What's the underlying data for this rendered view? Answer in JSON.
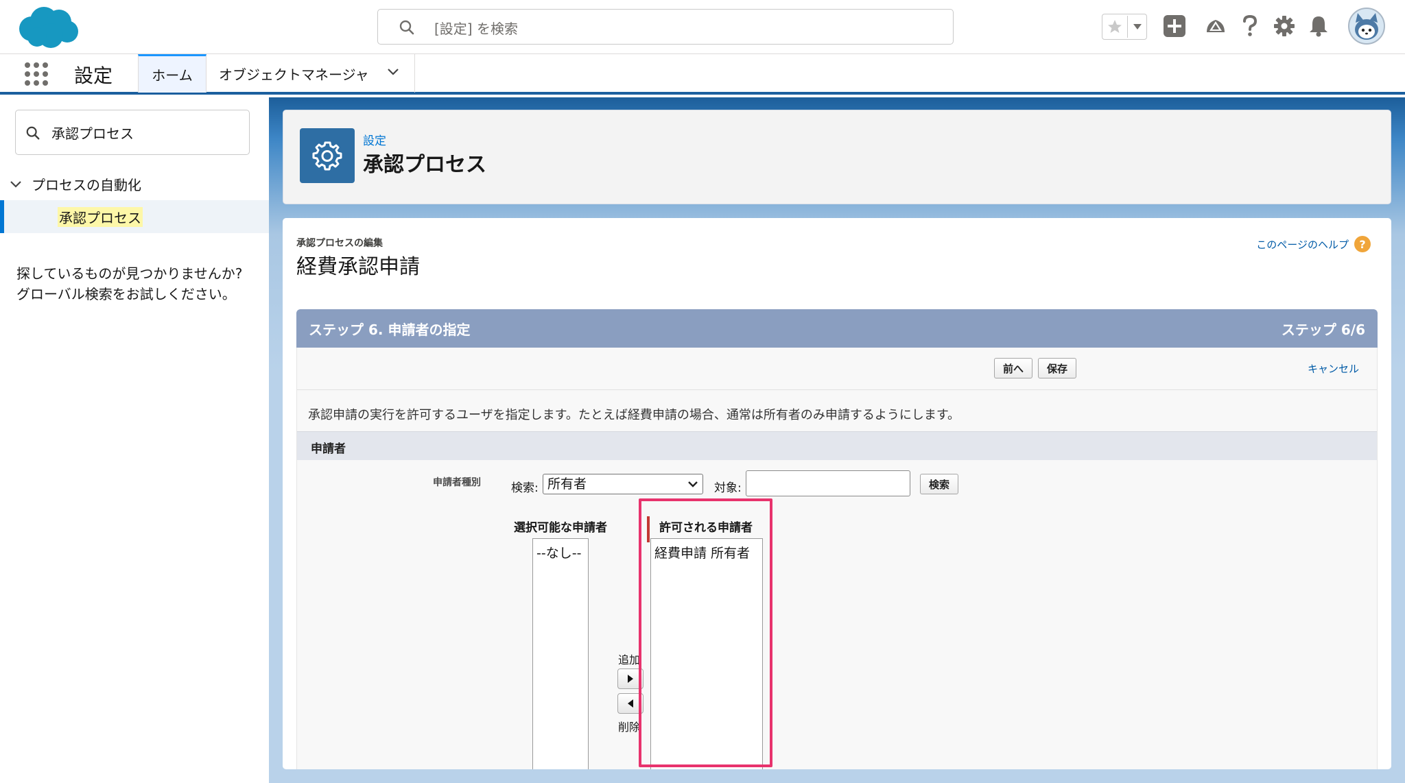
{
  "header": {
    "search_placeholder": "[設定] を検索",
    "icons": [
      "salesforce-cloud-icon",
      "search-icon",
      "star-icon",
      "chevron-down-icon",
      "plus-icon",
      "trailhead-icon",
      "help-icon",
      "gear-icon",
      "bell-icon",
      "avatar"
    ]
  },
  "nav": {
    "app_name": "設定",
    "tabs": [
      {
        "label": "ホーム",
        "active": true
      },
      {
        "label": "オブジェクトマネージャ",
        "active": false
      }
    ]
  },
  "sidebar": {
    "quick_find_value": "承認プロセス",
    "tree_parent": "プロセスの自動化",
    "tree_child": "承認プロセス",
    "help_line1": "探しているものが見つかりませんか?",
    "help_line2": "グローバル検索をお試しください。"
  },
  "page_header": {
    "breadcrumb": "設定",
    "title": "承認プロセス"
  },
  "card": {
    "edit_label": "承認プロセスの編集",
    "record_title": "経費承認申請",
    "page_help": "このページのヘルプ",
    "step_title": "ステップ 6. 申請者の指定",
    "step_count": "ステップ 6/6",
    "buttons": {
      "prev": "前へ",
      "save": "保存",
      "cancel": "キャンセル"
    },
    "description": "承認申請の実行を許可するユーザを指定します。たとえば経費申請の場合、通常は所有者のみ申請するようにします。",
    "section_title": "申請者",
    "submitter_type_label": "申請者種別",
    "search_label": "検索:",
    "search_select_value": "所有者",
    "target_label": "対象:",
    "target_value": "",
    "search_button": "検索",
    "available_header": "選択可能な申請者",
    "available_items": [
      "--なし--"
    ],
    "add_label": "追加",
    "remove_label": "削除",
    "allowed_header": "許可される申請者",
    "allowed_items": [
      "経費申請 所有者"
    ]
  },
  "colors": {
    "brand_blue": "#0176d3",
    "step_bar": "#8a9ec0",
    "highlight_annotation": "#e8336d"
  }
}
